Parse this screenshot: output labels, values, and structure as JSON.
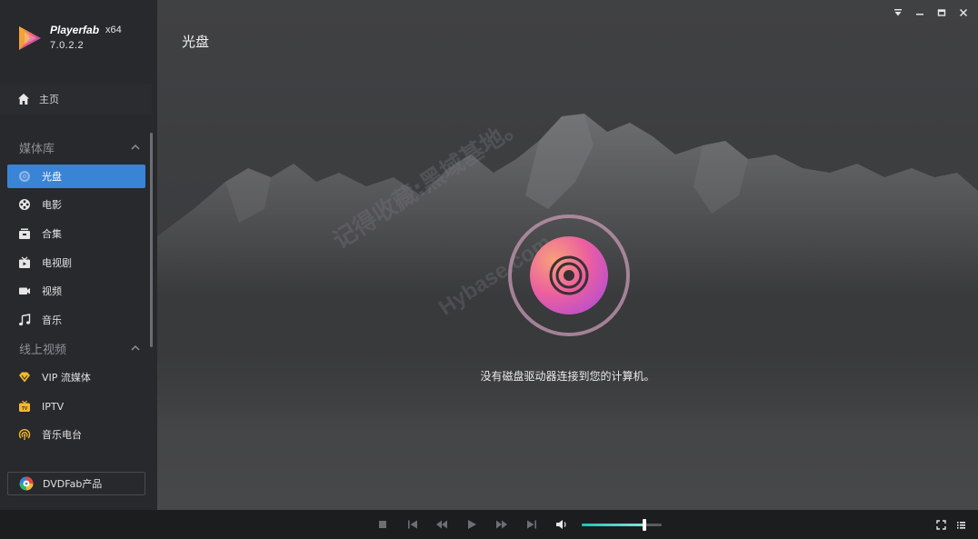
{
  "app": {
    "name": "Playerfab",
    "arch": "x64",
    "version": "7.0.2.2"
  },
  "sidebar": {
    "home_label": "主页",
    "library_title": "媒体库",
    "library_items": [
      {
        "label": "光盘",
        "icon": "disc-icon",
        "active": true
      },
      {
        "label": "电影",
        "icon": "film-reel-icon",
        "active": false
      },
      {
        "label": "合集",
        "icon": "collection-icon",
        "active": false
      },
      {
        "label": "电视剧",
        "icon": "tv-icon",
        "active": false
      },
      {
        "label": "视频",
        "icon": "video-camera-icon",
        "active": false
      },
      {
        "label": "音乐",
        "icon": "music-note-icon",
        "active": false
      }
    ],
    "online_title": "线上视频",
    "online_items": [
      {
        "label": "VIP 流媒体",
        "icon": "vip-diamond-icon"
      },
      {
        "label": "IPTV",
        "icon": "iptv-icon"
      },
      {
        "label": "音乐电台",
        "icon": "radio-icon"
      }
    ],
    "dvdfab_label": "DVDFab产品"
  },
  "main": {
    "page_title": "光盘",
    "empty_message": "没有磁盘驱动器连接到您的计算机。",
    "watermark_cn": "记得收藏:黑域基地。",
    "watermark_en": "Hybase.com"
  },
  "player": {
    "volume_level": 0.78
  },
  "colors": {
    "accent": "#3a84d6",
    "sidebar_bg": "#27292c",
    "volume_fill": "#22c3b8"
  }
}
